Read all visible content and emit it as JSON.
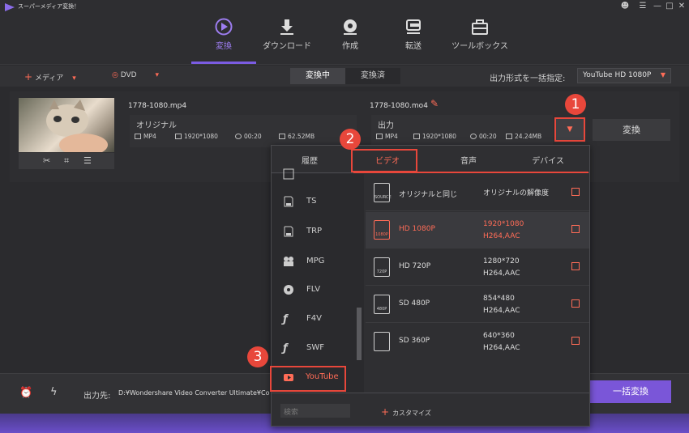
{
  "titlebar": {
    "title": "スーパーメディア変換！",
    "buttons": [
      "user-icon",
      "menu-icon",
      "minimize-icon",
      "maximize-icon",
      "close-icon"
    ]
  },
  "mainnav": {
    "items": [
      {
        "label": "変換",
        "icon": "convert-icon",
        "active": true
      },
      {
        "label": "ダウンロード",
        "icon": "download-icon"
      },
      {
        "label": "作成",
        "icon": "burn-icon"
      },
      {
        "label": "転送",
        "icon": "transfer-icon"
      },
      {
        "label": "ツールボックス",
        "icon": "toolbox-icon"
      }
    ]
  },
  "toolbar": {
    "add_media": "メディア",
    "dvd": "DVD",
    "tabs": [
      "変換中",
      "変換済"
    ],
    "active_tab": "変換中",
    "format_label": "出力形式を一括指定:",
    "format_value": "YouTube HD 1080P"
  },
  "file": {
    "source_name": "1778-1080.mp4",
    "output_name": "1778-1080.mo4",
    "original_title": "オリジナル",
    "original_meta": {
      "format": "MP4",
      "resolution": "1920*1080",
      "duration": "00:20",
      "size": "62.52MB"
    },
    "output_title": "出力",
    "output_meta": {
      "format": "MP4",
      "resolution": "1920*1080",
      "duration": "00:20",
      "size": "24.24MB"
    },
    "convert_label": "変換"
  },
  "panel": {
    "tabs": [
      "履歴",
      "ビデオ",
      "音声",
      "デバイス"
    ],
    "active_tab": "ビデオ",
    "left_items": [
      {
        "label": "TS",
        "icon": "ts-icon"
      },
      {
        "label": "TRP",
        "icon": "trp-icon"
      },
      {
        "label": "MPG",
        "icon": "mpg-icon"
      },
      {
        "label": "FLV",
        "icon": "flv-icon"
      },
      {
        "label": "F4V",
        "icon": "f4v-icon"
      },
      {
        "label": "SWF",
        "icon": "swf-icon"
      },
      {
        "label": "YouTube",
        "icon": "youtube-icon",
        "selected": true
      }
    ],
    "right_items": [
      {
        "name": "オリジナルと同じ",
        "spec1": "オリジナルの解像度",
        "spec2": "",
        "icon_text": "SOURCE"
      },
      {
        "name": "HD 1080P",
        "spec1": "1920*1080",
        "spec2": "H264,AAC",
        "icon_text": "1080P",
        "selected": true
      },
      {
        "name": "HD 720P",
        "spec1": "1280*720",
        "spec2": "H264,AAC",
        "icon_text": "720P"
      },
      {
        "name": "SD 480P",
        "spec1": "854*480",
        "spec2": "H264,AAC",
        "icon_text": "480P"
      },
      {
        "name": "SD 360P",
        "spec1": "640*360",
        "spec2": "H264,AAC",
        "icon_text": ""
      }
    ],
    "search_placeholder": "検索",
    "customize_label": "カスタマイズ"
  },
  "bottombar": {
    "output_label": "出力先:",
    "output_path": "D:¥Wondershare Video Converter Ultimate¥Co",
    "batch_convert": "一括変換"
  },
  "callouts": [
    "1",
    "2",
    "3"
  ],
  "colors": {
    "accent": "#7b5ce3",
    "highlight": "#e8473b",
    "selected_text": "#ff6c57"
  }
}
